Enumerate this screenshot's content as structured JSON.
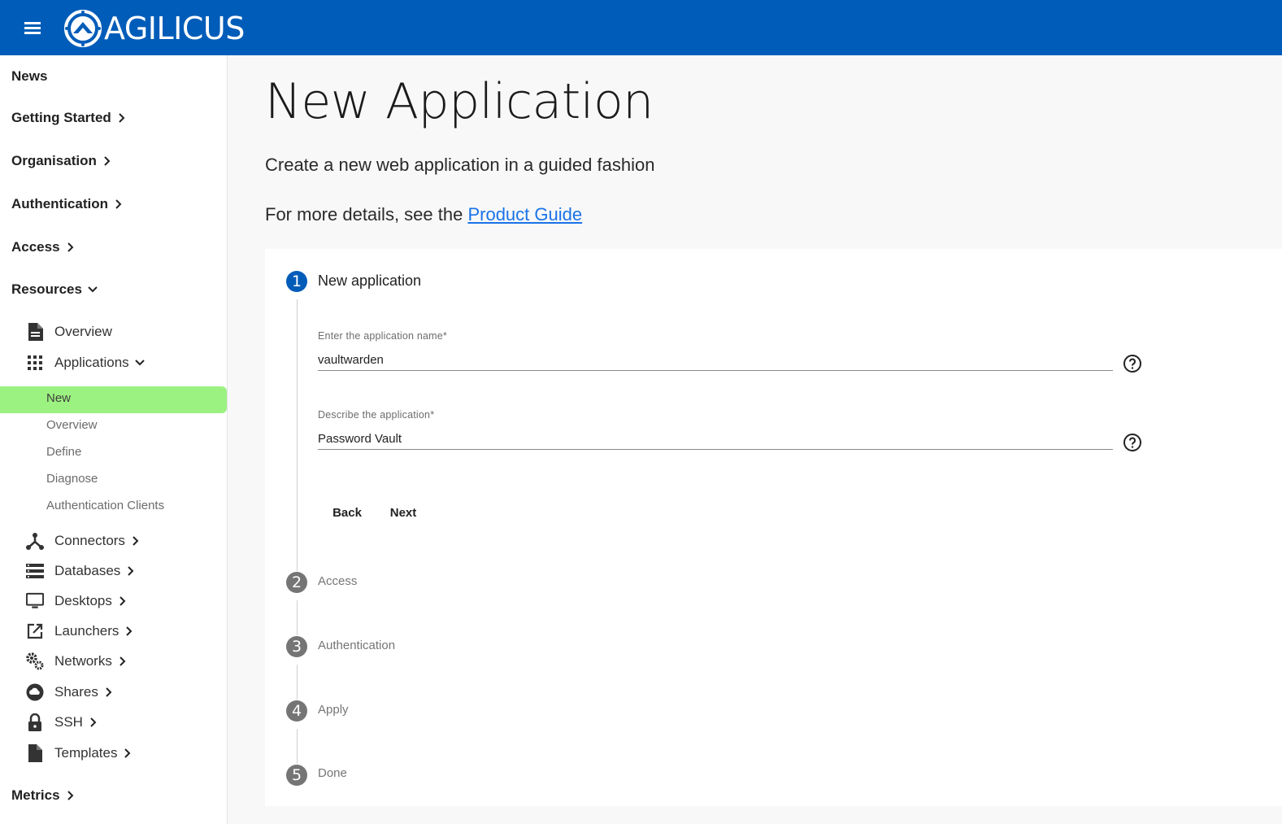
{
  "header": {
    "brand": "AGILICUS"
  },
  "sidebar": {
    "top_items": [
      {
        "label": "News"
      },
      {
        "label": "Getting Started"
      },
      {
        "label": "Organisation"
      },
      {
        "label": "Authentication"
      },
      {
        "label": "Access"
      },
      {
        "label": "Resources"
      }
    ],
    "resources": {
      "overview": "Overview",
      "applications": "Applications",
      "sub_items": [
        "New",
        "Overview",
        "Define",
        "Diagnose",
        "Authentication Clients"
      ],
      "others": [
        "Connectors",
        "Databases",
        "Desktops",
        "Launchers",
        "Networks",
        "Shares",
        "SSH",
        "Templates"
      ]
    },
    "metrics": "Metrics"
  },
  "main": {
    "title": "New Application",
    "lead": "Create a new web application in a guided fashion",
    "details_prefix": "For more details, see the ",
    "details_link": "Product Guide"
  },
  "stepper": {
    "steps": [
      {
        "num": "1",
        "label": "New application"
      },
      {
        "num": "2",
        "label": "Access"
      },
      {
        "num": "3",
        "label": "Authentication"
      },
      {
        "num": "4",
        "label": "Apply"
      },
      {
        "num": "5",
        "label": "Done"
      }
    ],
    "fields": {
      "name_label": "Enter the application name",
      "name_value": "vaultwarden",
      "desc_label": "Describe the application",
      "desc_value": "Password Vault",
      "required_mark": "*"
    },
    "buttons": {
      "back": "Back",
      "next": "Next"
    }
  },
  "colors": {
    "brand": "#005cb9",
    "active_nav": "#9cf281",
    "link": "#1a73e8"
  }
}
